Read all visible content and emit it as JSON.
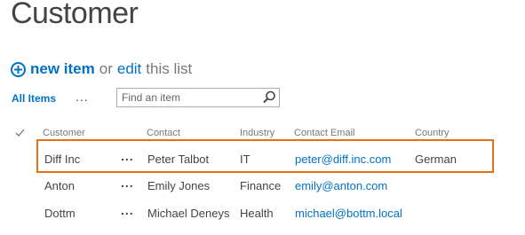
{
  "page": {
    "title": "Customer"
  },
  "command_bar": {
    "new_item_label": "new item",
    "or_text": "or",
    "edit_label": "edit",
    "this_list_text": "this list"
  },
  "view": {
    "current_view": "All Items",
    "more_label": "..."
  },
  "search": {
    "placeholder": "Find an item",
    "value": ""
  },
  "table": {
    "headers": {
      "customer": "Customer",
      "contact": "Contact",
      "industry": "Industry",
      "email": "Contact Email",
      "country": "Country"
    },
    "rows": [
      {
        "customer": "Diff Inc",
        "actions": "...",
        "contact": "Peter Talbot",
        "industry": "IT",
        "email": "peter@diff.inc.com",
        "country": "German"
      },
      {
        "customer": "Anton",
        "actions": "...",
        "contact": "Emily Jones",
        "industry": "Finance",
        "email": "emily@anton.com",
        "country": ""
      },
      {
        "customer": "Dottm",
        "actions": "...",
        "contact": "Michael Deneys",
        "industry": "Health",
        "email": "michael@bottm.local",
        "country": ""
      }
    ],
    "highlighted_row_index": 0
  },
  "colors": {
    "accent": "#0072c6",
    "highlight_border": "#e0721b",
    "text": "#444444",
    "muted": "#777777"
  },
  "icons": {
    "new_item": "plus-circle-icon",
    "search": "magnifier-icon",
    "select_all": "checkmark-icon"
  }
}
